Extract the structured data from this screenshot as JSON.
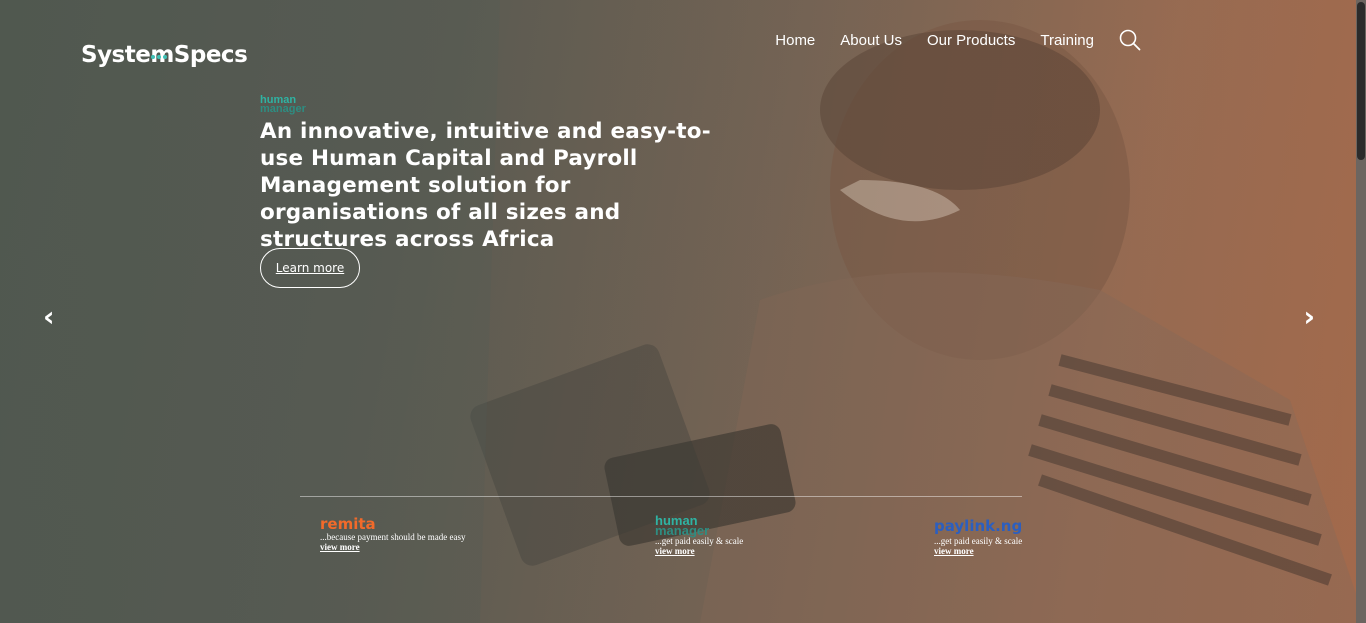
{
  "brand": {
    "name": "SystemSpecs"
  },
  "nav": {
    "items": [
      "Home",
      "About Us",
      "Our Products",
      "Training"
    ],
    "search_icon": "search-icon"
  },
  "hero": {
    "product_logo": {
      "line1": "human",
      "line2": "manager"
    },
    "headline": "An innovative, intuitive and easy-to-use Human Capital and Payroll Management solution for organisations of all sizes and structures across Africa",
    "cta_label": "Learn more",
    "prev_arrow": "‹",
    "next_arrow": "›"
  },
  "products": [
    {
      "brand": "remita",
      "tagline": "...because payment should be made easy",
      "link": "view more"
    },
    {
      "brand_line1": "human",
      "brand_line2": "manager",
      "tagline": "...get paid easily & scale",
      "link": "view more"
    },
    {
      "brand": "paylink.ng",
      "tagline": "...get paid easily & scale",
      "link": "view more"
    }
  ],
  "colors": {
    "remita": "#f26a2a",
    "humanmanager": "#2fb3a3",
    "paylink": "#2c5fbf",
    "logo_dots": "#3fc1b6"
  }
}
